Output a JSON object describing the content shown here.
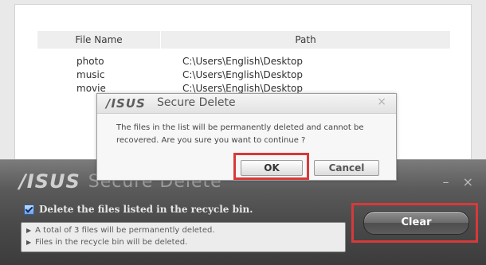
{
  "file_list": {
    "headers": {
      "name": "File Name",
      "path": "Path"
    },
    "rows": [
      {
        "name": "photo",
        "path": "C:\\Users\\English\\Desktop"
      },
      {
        "name": "music",
        "path": "C:\\Users\\English\\Desktop"
      },
      {
        "name": "movie",
        "path": "C:\\Users\\English\\Desktop"
      }
    ]
  },
  "main_window": {
    "logo": "/ISUS",
    "title": "Secure Delete",
    "minimize": "–",
    "close": "×",
    "checkbox_label": "Delete the files listed in the recycle bin.",
    "info_lines": [
      "A total of 3 files will be permanently deleted.",
      "Files in the recycle bin will be deleted."
    ],
    "clear_label": "Clear"
  },
  "dialog": {
    "logo": "/ISUS",
    "title": "Secure Delete",
    "close": "×",
    "message": "The files in the list will be permanently deleted and cannot be recovered. Are you sure you want to continue ?",
    "ok_label": "OK",
    "cancel_label": "Cancel"
  },
  "colors": {
    "highlight": "#d63a3a",
    "window_dark": "#4a4a4a"
  }
}
